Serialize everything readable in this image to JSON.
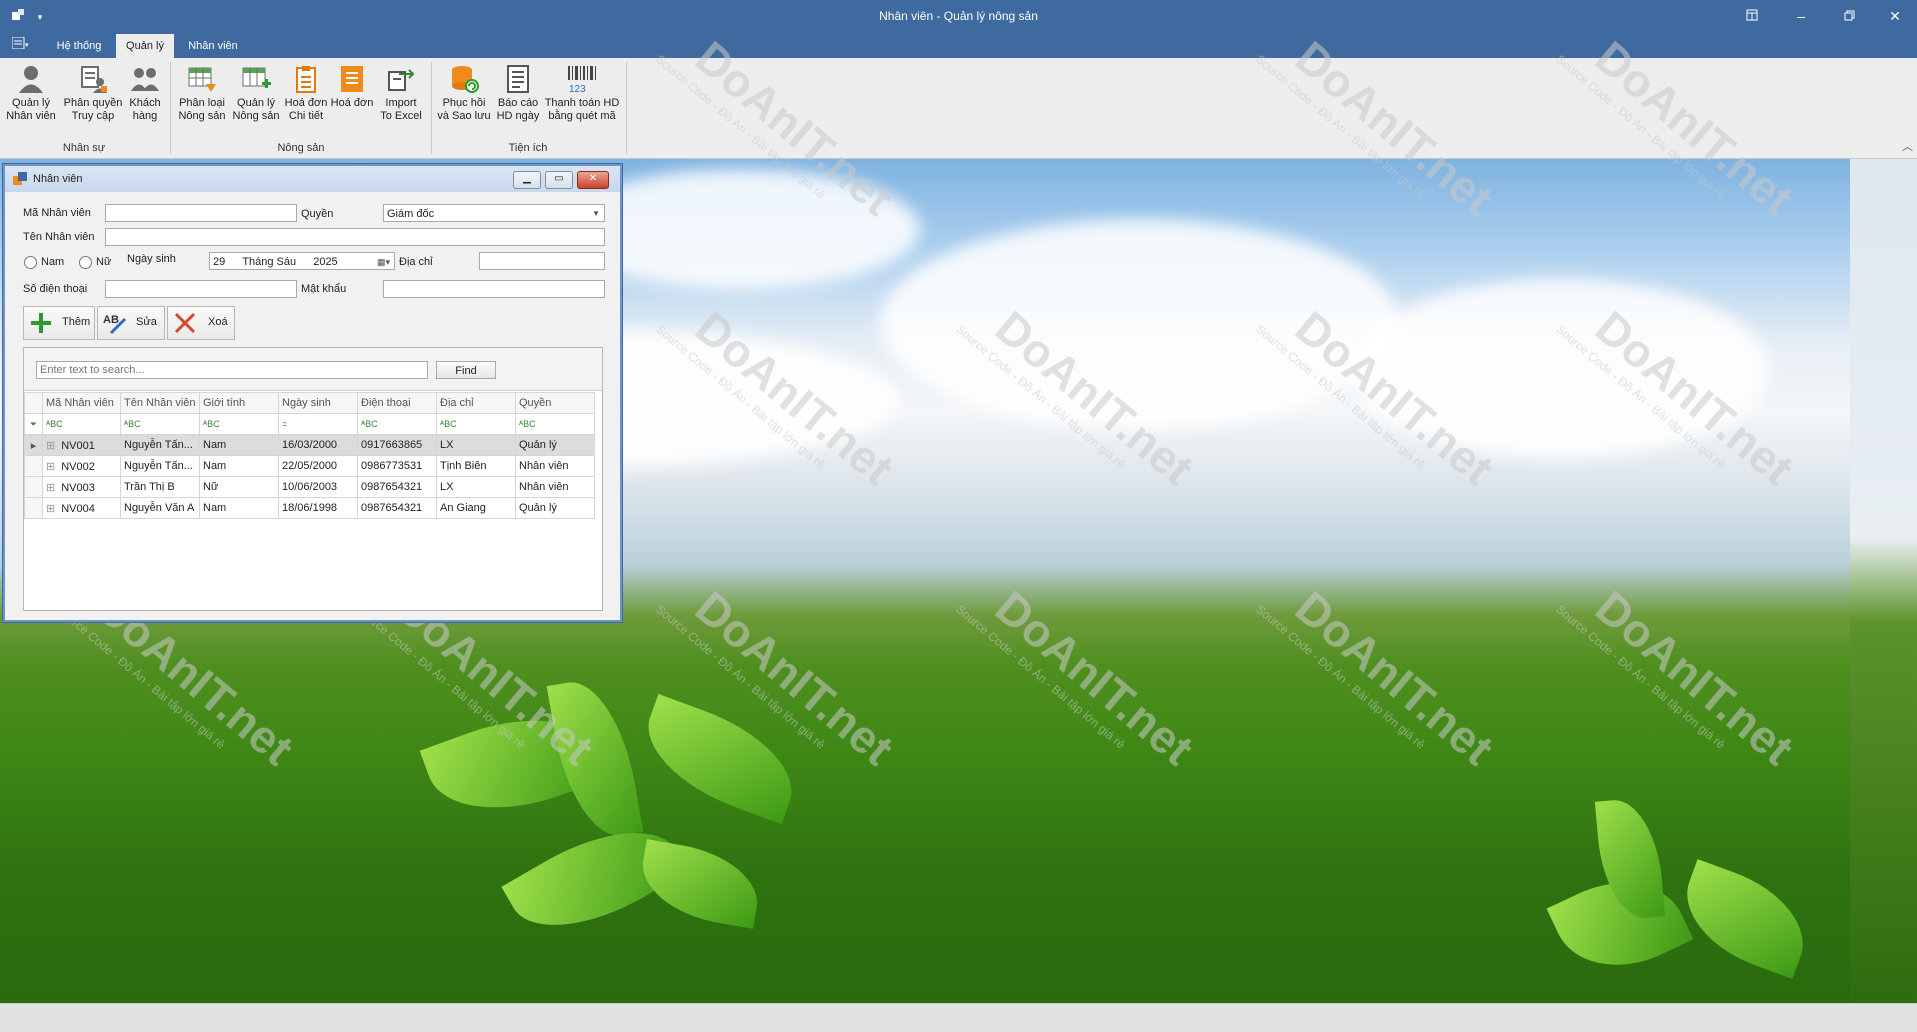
{
  "window": {
    "title": "Nhân viên - Quản lý nông sản"
  },
  "tabs": [
    "Hệ thống",
    "Quản lý",
    "Nhân viên"
  ],
  "ribbon": {
    "groups": [
      {
        "label": "Nhân sự",
        "buttons": [
          {
            "line1": "Quản lý",
            "line2": "Nhân viên"
          },
          {
            "line1": "Phân quyền",
            "line2": "Truy cập"
          },
          {
            "line1": "Khách",
            "line2": "hàng"
          }
        ]
      },
      {
        "label": "Nông sản",
        "buttons": [
          {
            "line1": "Phân loại",
            "line2": "Nông sản"
          },
          {
            "line1": "Quản lý",
            "line2": "Nông sản"
          },
          {
            "line1": "Hoá đơn",
            "line2": "Chi tiết"
          },
          {
            "line1": "Hoá đơn",
            "line2": ""
          },
          {
            "line1": "Import",
            "line2": "To Excel"
          }
        ]
      },
      {
        "label": "Tiện ích",
        "buttons": [
          {
            "line1": "Phục hồi",
            "line2": "và Sao lưu"
          },
          {
            "line1": "Báo cáo",
            "line2": "HD ngày"
          },
          {
            "line1": "Thanh toán HD",
            "line2": "bằng quét mã"
          }
        ]
      }
    ]
  },
  "form": {
    "title": "Nhân viên",
    "ma_nv_label": "Mã Nhân viên",
    "ma_nv_value": "",
    "quyen_label": "Quyền",
    "quyen_value": "Giám đốc",
    "ten_nv_label": "Tên Nhân viên",
    "ten_nv_value": "",
    "gender_male": "Nam",
    "gender_female": "Nữ",
    "ngay_sinh_label": "Ngày sinh",
    "ngay_sinh_day": "29",
    "ngay_sinh_month": "Tháng Sáu",
    "ngay_sinh_year": "2025",
    "dia_chi_label": "Địa chỉ",
    "dia_chi_value": "",
    "sdt_label": "Số điện thoại",
    "sdt_value": "",
    "mat_khau_label": "Mật khẩu",
    "mat_khau_value": "",
    "btn_them": "Thêm",
    "btn_sua": "Sửa",
    "btn_xoa": "Xoá"
  },
  "search": {
    "placeholder": "Enter text to search...",
    "find_label": "Find"
  },
  "grid": {
    "columns": [
      "Mã Nhân viên",
      "Tên Nhân viên",
      "Giới tính",
      "Ngày sinh",
      "Điện thoại",
      "Địa chỉ",
      "Quyền"
    ],
    "filter_glyphs": [
      "ᴬBC",
      "ᴬBC",
      "ᴬBC",
      "=",
      "ᴬBC",
      "ᴬBC",
      "ᴬBC"
    ],
    "rows": [
      [
        "NV001",
        "Nguyễn Tấn...",
        "Nam",
        "16/03/2000",
        "0917663865",
        "LX",
        "Quản lý"
      ],
      [
        "NV002",
        "Nguyễn Tấn...",
        "Nam",
        "22/05/2000",
        "0986773531",
        "Tịnh Biên",
        "Nhân viên"
      ],
      [
        "NV003",
        "Trần Thị B",
        "Nữ",
        "10/06/2003",
        "0987654321",
        "LX",
        "Nhân viên"
      ],
      [
        "NV004",
        "Nguyễn Văn A",
        "Nam",
        "18/06/1998",
        "0987654321",
        "An Giang",
        "Quản lý"
      ]
    ]
  },
  "watermark": {
    "brand": "DoAnIT.net",
    "tagline": "Source Code - Đồ Án - Bài tập lớn giá rẻ"
  },
  "colors": {
    "titlebar": "#3f6aa0",
    "ribbon": "#ededed",
    "accent_orange": "#f08a1a"
  }
}
